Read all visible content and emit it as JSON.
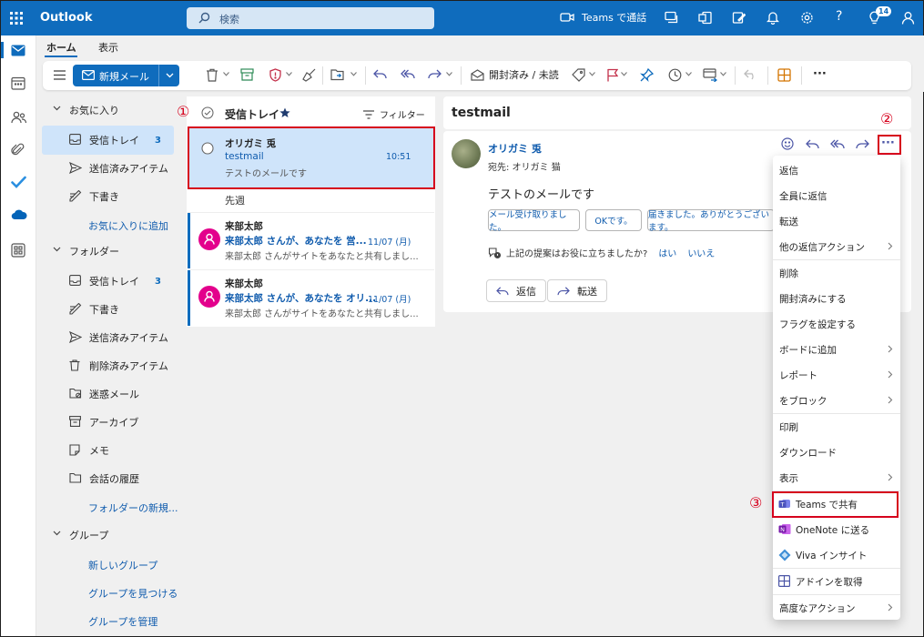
{
  "header": {
    "app_name": "Outlook",
    "search_placeholder": "検索",
    "teams_call": "Teams で通話",
    "badge_count": "14"
  },
  "ribbon": {
    "tabs": [
      "ホーム",
      "表示"
    ],
    "new_mail": "新規メール",
    "mark_read": "開封済み / 未読"
  },
  "folder_pane": {
    "favorites_label": "お気に入り",
    "favorites": [
      {
        "label": "受信トレイ",
        "count": "3"
      },
      {
        "label": "送信済みアイテム",
        "count": ""
      },
      {
        "label": "下書き",
        "count": ""
      }
    ],
    "add_favorite": "お気に入りに追加",
    "folders_label": "フォルダー",
    "folders": [
      {
        "label": "受信トレイ",
        "count": "3"
      },
      {
        "label": "下書き",
        "count": ""
      },
      {
        "label": "送信済みアイテム",
        "count": ""
      },
      {
        "label": "削除済みアイテム",
        "count": ""
      },
      {
        "label": "迷惑メール",
        "count": ""
      },
      {
        "label": "アーカイブ",
        "count": ""
      },
      {
        "label": "メモ",
        "count": ""
      },
      {
        "label": "会話の履歴",
        "count": ""
      }
    ],
    "new_folder": "フォルダーの新規...",
    "groups_label": "グループ",
    "groups": [
      "新しいグループ",
      "グループを見つける",
      "グループを管理"
    ]
  },
  "message_list": {
    "title": "受信トレイ",
    "filter": "フィルター",
    "week_label": "先週",
    "messages": [
      {
        "sender": "オリガミ 兎",
        "subject": "testmail",
        "preview": "テストのメールです",
        "time": "10:51"
      },
      {
        "sender": "来部太郎",
        "subject": "来部太郎 さんが、あなたを 営...",
        "preview": "来部太郎 さんがサイトをあなたと共有しまし...",
        "time": "11/07 (月)"
      },
      {
        "sender": "来部太郎",
        "subject": "来部太郎 さんが、あなたを オリ...",
        "preview": "来部太郎 さんがサイトをあなたと共有しまし...",
        "time": "11/07 (月)"
      }
    ]
  },
  "reading_pane": {
    "subject": "testmail",
    "sender": "オリガミ 兎",
    "to": "宛先: オリガミ 猫",
    "body": "テストのメールです",
    "suggestions": [
      "メール受け取りました。",
      "OKです。",
      "届きました。ありがとうございます。"
    ],
    "feedback_q": "上記の提案はお役に立ちましたか?",
    "feedback_yes": "はい",
    "feedback_no": "いいえ",
    "reply": "返信",
    "forward": "転送"
  },
  "context_menu": {
    "items": [
      "返信",
      "全員に返信",
      "転送",
      "他の返信アクション",
      "削除",
      "開封済みにする",
      "フラグを設定する",
      "ボードに追加",
      "レポート",
      "をブロック",
      "印刷",
      "ダウンロード",
      "表示",
      "Teams で共有",
      "OneNote に送る",
      "Viva インサイト",
      "アドインを取得",
      "高度なアクション"
    ]
  },
  "annotations": {
    "n1": "①",
    "n2": "②",
    "n3": "③"
  },
  "colors": {
    "brand": "#0f6cbd",
    "annotation": "#d6001c",
    "selected": "#cfe4fa"
  }
}
